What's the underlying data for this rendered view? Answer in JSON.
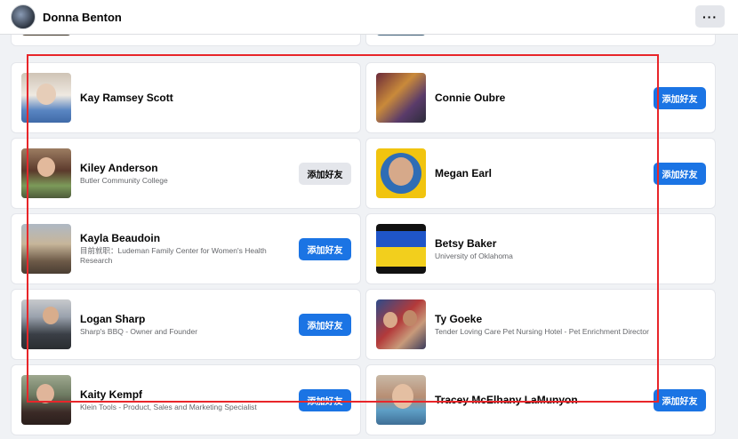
{
  "header": {
    "profile_name": "Donna Benton",
    "more_label": "···"
  },
  "cards": [
    {
      "name": "Kay Ramsey Scott",
      "subtitle": "",
      "button": ""
    },
    {
      "name": "Connie Oubre",
      "subtitle": "",
      "button": "添加好友"
    },
    {
      "name": "Kiley Anderson",
      "subtitle": "Butler Community College",
      "button": "添加好友"
    },
    {
      "name": "Megan Earl",
      "subtitle": "",
      "button": "添加好友"
    },
    {
      "name": "Kayla Beaudoin",
      "subtitle": "目前就职：Ludeman Family Center for Women's Health Research",
      "button": "添加好友"
    },
    {
      "name": "Betsy Baker",
      "subtitle": "University of Oklahoma",
      "button": ""
    },
    {
      "name": "Logan Sharp",
      "subtitle": "Sharp's BBQ - Owner and Founder",
      "button": "添加好友"
    },
    {
      "name": "Ty Goeke",
      "subtitle": "Tender Loving Care Pet Nursing Hotel - Pet Enrichment Director",
      "button": ""
    },
    {
      "name": "Kaity Kempf",
      "subtitle": "Klein Tools - Product, Sales and Marketing Specialist",
      "button": "添加好友"
    },
    {
      "name": "Tracey McElhany LaMunyon",
      "subtitle": "",
      "button": "添加好友"
    }
  ],
  "colors": {
    "primary_button": "#1b74e4",
    "secondary_button": "#e4e6eb",
    "highlight_box": "#e8262a"
  }
}
